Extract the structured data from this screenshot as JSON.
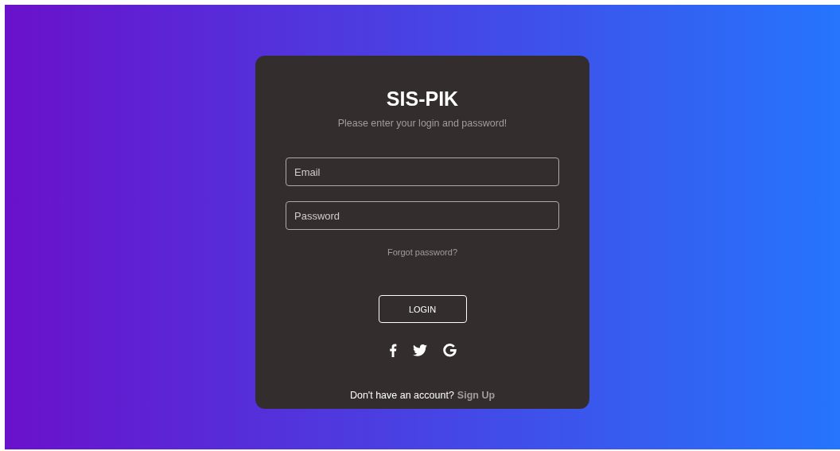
{
  "title": "SIS-PIK",
  "subtitle": "Please enter your login and password!",
  "fields": [
    {
      "placeholder": "Email"
    },
    {
      "placeholder": "Password"
    }
  ],
  "forgot_link": "Forgot password?",
  "login_button": "LOGIN",
  "social": [
    {
      "kind": "facebook"
    },
    {
      "kind": "twitter"
    },
    {
      "kind": "google"
    }
  ],
  "footer": {
    "text": "Don't have an account?",
    "link": "Sign Up"
  }
}
